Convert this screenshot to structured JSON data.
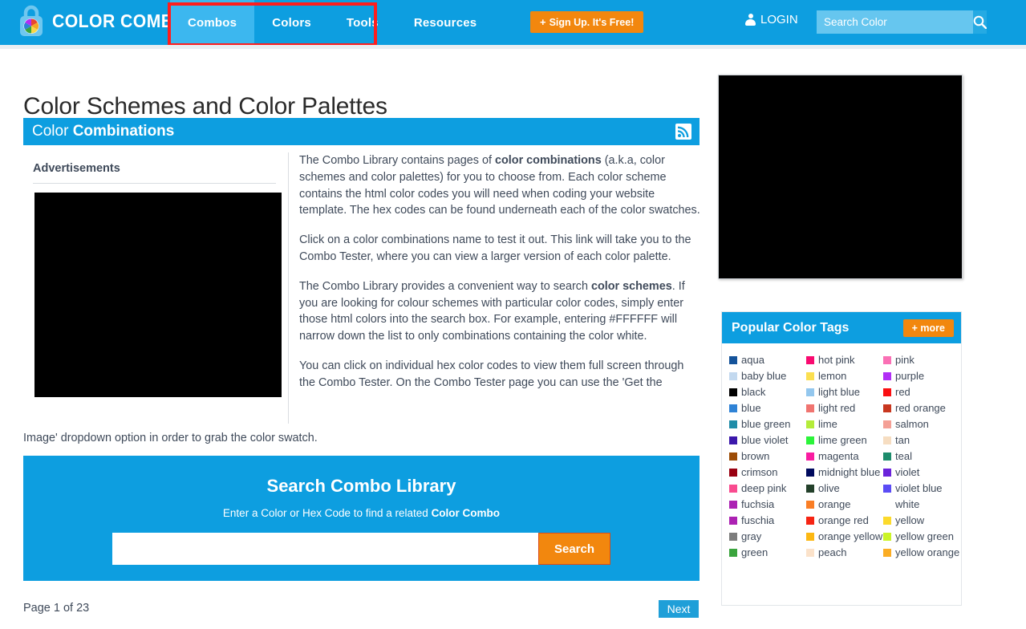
{
  "header": {
    "logo_text": "COLOR COMBOS",
    "logo_icon": "padlock-colorwheel-icon",
    "nav": [
      {
        "label": "Combos",
        "active": true
      },
      {
        "label": "Colors",
        "active": false
      },
      {
        "label": "Tools",
        "active": false
      },
      {
        "label": "Resources",
        "active": false
      }
    ],
    "signup_plus": "+",
    "signup_label": "Sign Up. It's Free!",
    "login_label": "LOGIN",
    "login_icon": "person-icon",
    "search_placeholder": "Search Color",
    "search_value": "",
    "search_icon": "magnifier-icon",
    "accent_blue": "#0d9ee0",
    "accent_orange": "#f2870e",
    "annotation_color": "#ff1d1d"
  },
  "page": {
    "title": "Color Schemes and Color Palettes",
    "section_title_light": "Color ",
    "section_title_bold": "Combinations",
    "rss_icon": "rss-feed-icon"
  },
  "left": {
    "ads_label": "Advertisements",
    "ad_placeholder": "advertisement-banner"
  },
  "copy": {
    "p1_a": "The Combo Library contains pages of ",
    "p1_b": "color combinations",
    "p1_c": " (a.k.a, color schemes and color palettes) for you to choose from. Each color scheme contains the html color codes you will need when coding your website template. The hex codes can be found underneath each of the color swatches.",
    "p2": "Click on a color combinations name to test it out. This link will take you to the Combo Tester, where you can view a larger version of each color palette.",
    "p3_a": "The Combo Library provides a convenient way to search ",
    "p3_b": "color schemes",
    "p3_c": ". If you are looking for colour schemes with particular color codes, simply enter those html colors into the search box. For example, entering #FFFFFF will narrow down the list to only combinations containing the color white.",
    "p4": "You can click on individual hex color codes to view them full screen through the Combo Tester. On the Combo Tester page you can use the 'Get the",
    "p4_tail": "Image' dropdown option in order to grab the color swatch."
  },
  "search_panel": {
    "title": "Search Combo Library",
    "subtitle_a": "Enter a Color or Hex Code to find a related ",
    "subtitle_b": "Color Combo",
    "input_value": "",
    "input_placeholder": "",
    "button_label": "Search"
  },
  "pagination": {
    "status": "Page 1 of 23",
    "next_label": "Next"
  },
  "tags": {
    "title": "Popular Color Tags",
    "more_label": "+ more",
    "columns": [
      [
        {
          "label": "aqua",
          "color": "#14539a"
        },
        {
          "label": "baby blue",
          "color": "#c3d9ef"
        },
        {
          "label": "black",
          "color": "#000000"
        },
        {
          "label": "blue",
          "color": "#2f83d6"
        },
        {
          "label": "blue green",
          "color": "#1f8ca8"
        },
        {
          "label": "blue violet",
          "color": "#3b18ab"
        },
        {
          "label": "brown",
          "color": "#9c4c06"
        },
        {
          "label": "crimson",
          "color": "#990011"
        },
        {
          "label": "deep pink",
          "color": "#f94b8f"
        },
        {
          "label": "fuchsia",
          "color": "#ac22b3"
        },
        {
          "label": "fuschia",
          "color": "#ac22b3"
        },
        {
          "label": "gray",
          "color": "#7d7d7d"
        },
        {
          "label": "green",
          "color": "#3aa43d"
        }
      ],
      [
        {
          "label": "hot pink",
          "color": "#f90a70"
        },
        {
          "label": "lemon",
          "color": "#fbdf50"
        },
        {
          "label": "light blue",
          "color": "#93c7ee"
        },
        {
          "label": "light red",
          "color": "#f07470"
        },
        {
          "label": "lime",
          "color": "#b4ec3a"
        },
        {
          "label": "lime green",
          "color": "#2bf43a"
        },
        {
          "label": "magenta",
          "color": "#f91ca1"
        },
        {
          "label": "midnight blue",
          "color": "#000a5e"
        },
        {
          "label": "olive",
          "color": "#23402a"
        },
        {
          "label": "orange",
          "color": "#fa7e25"
        },
        {
          "label": "orange red",
          "color": "#f62413"
        },
        {
          "label": "orange yellow",
          "color": "#fcb813"
        },
        {
          "label": "peach",
          "color": "#fbe2ca"
        }
      ],
      [
        {
          "label": "pink",
          "color": "#fa70b5"
        },
        {
          "label": "purple",
          "color": "#b12ef6"
        },
        {
          "label": "red",
          "color": "#fa0f12"
        },
        {
          "label": "red orange",
          "color": "#c8371f"
        },
        {
          "label": "salmon",
          "color": "#f4a096"
        },
        {
          "label": "tan",
          "color": "#f6ddc1"
        },
        {
          "label": "teal",
          "color": "#1d8c6c"
        },
        {
          "label": "violet",
          "color": "#6a23da"
        },
        {
          "label": "violet blue",
          "color": "#5b4cf5"
        },
        {
          "label": "white",
          "color": ""
        },
        {
          "label": "yellow",
          "color": "#fcda2c"
        },
        {
          "label": "yellow green",
          "color": "#cbf428"
        },
        {
          "label": "yellow orange",
          "color": "#fbad24"
        }
      ]
    ]
  }
}
